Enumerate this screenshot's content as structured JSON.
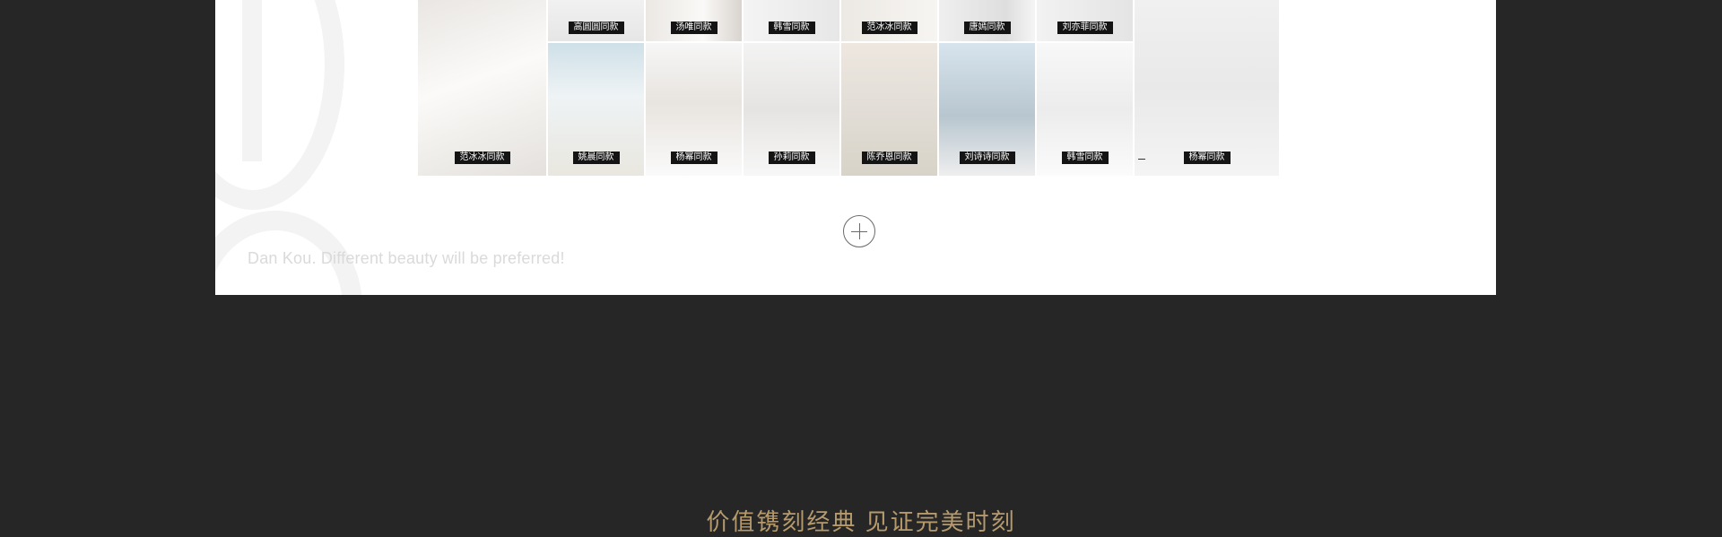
{
  "top_row_captions": [
    "高圆圆同款",
    "汤唯同款",
    "韩雪同款",
    "范冰冰同款",
    "唐嫣同款",
    "刘亦菲同款"
  ],
  "bottom_row_captions": [
    "范冰冰同款",
    "姚晨同款",
    "杨幂同款",
    "孙莉同款",
    "陈乔恩同款",
    "刘诗诗同款",
    "韩雪同款",
    "杨幂同款"
  ],
  "tagline": "Dan Kou. Different beauty will be preferred!",
  "slogan": "价值镌刻经典  见证完美时刻",
  "icons": {
    "expand": "plus-circle-icon"
  },
  "colors": {
    "background": "#262626",
    "panel": "#ffffff",
    "caption_bg": "#141414",
    "slogan": "#b69a6c"
  }
}
